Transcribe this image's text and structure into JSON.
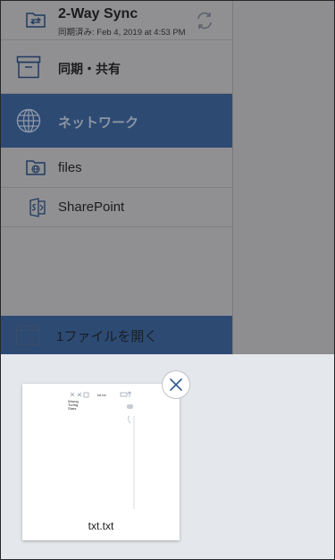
{
  "sidebar": {
    "sync_item": {
      "title": "2-Way Sync",
      "subtitle": "同期済み: Feb 4, 2019 at 4:53 PM",
      "icon": "two-way-sync-folder-icon",
      "action_icon": "refresh-icon"
    },
    "share_item": {
      "label": "同期・共有",
      "icon": "archive-box-icon"
    },
    "network_item": {
      "label": "ネットワーク",
      "icon": "globe-icon",
      "selected": true
    },
    "files_item": {
      "label": "files",
      "icon": "network-folder-icon"
    },
    "sharepoint_item": {
      "label": "SharePoint",
      "icon": "sharepoint-icon"
    }
  },
  "bottom_bar": {
    "label": "1ファイルを開く",
    "icon": "file-tray-icon"
  },
  "sheet": {
    "thumbnail": {
      "filename": "txt.txt",
      "preview_header": "txt.txt",
      "preview_text": [
        "Wrong",
        "Turing",
        "Stars"
      ]
    },
    "close_icon": "close-icon"
  },
  "colors": {
    "accent": "#2d4a73",
    "dim_overlay": "#8e8e90",
    "sheet_bg": "#e4e7eb"
  }
}
